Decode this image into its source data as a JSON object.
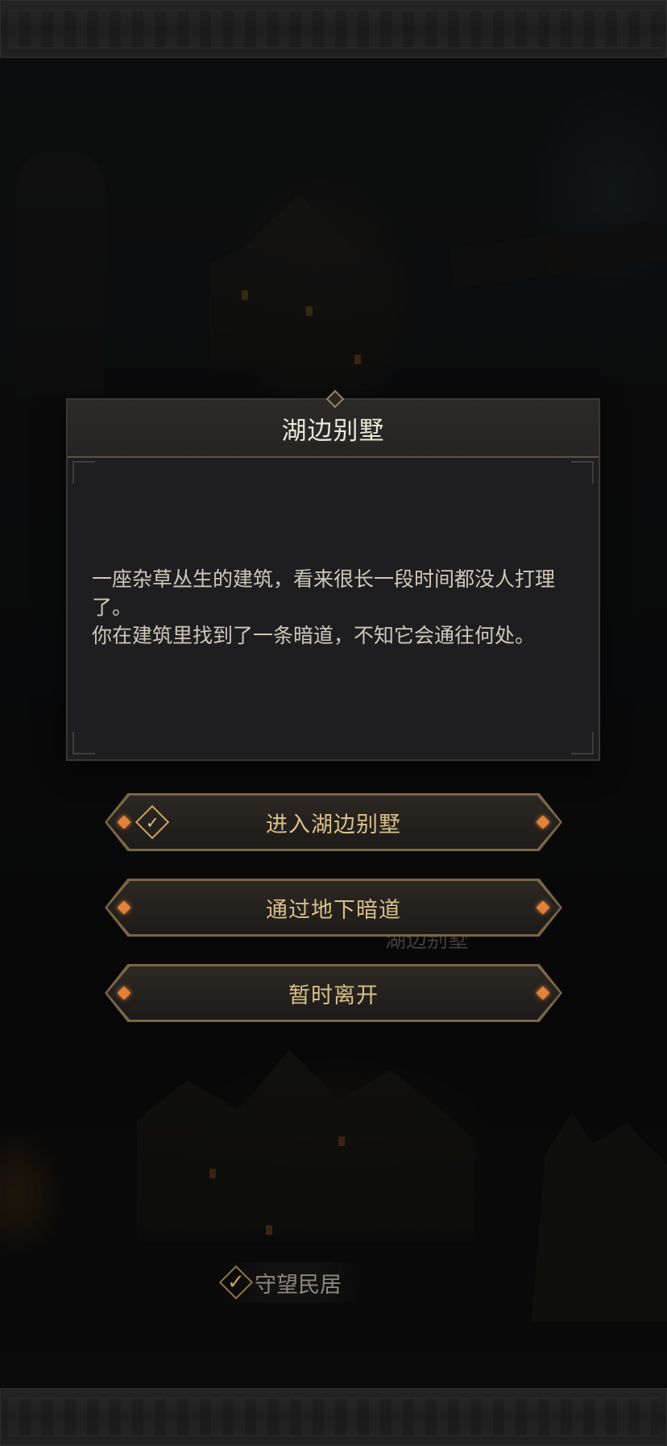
{
  "dialog": {
    "title": "湖边别墅",
    "description_line1": "一座杂草丛生的建筑，看来很长一段时间都没人打理了。",
    "description_line2": "你在建筑里找到了一条暗道，不知它会通往何处。"
  },
  "choices": [
    {
      "label": "进入湖边别墅",
      "icon": "diamond-check-icon"
    },
    {
      "label": "通过地下暗道"
    },
    {
      "label": "暂时离开"
    }
  ],
  "map": {
    "location_tag": {
      "label": "守望民居",
      "icon": "check-icon"
    },
    "faded_labels": [
      "湖边别墅"
    ]
  },
  "colors": {
    "accent_gold": "#d9c08a",
    "pip_orange": "#e0823a",
    "panel_bg": "#1e1e20"
  }
}
